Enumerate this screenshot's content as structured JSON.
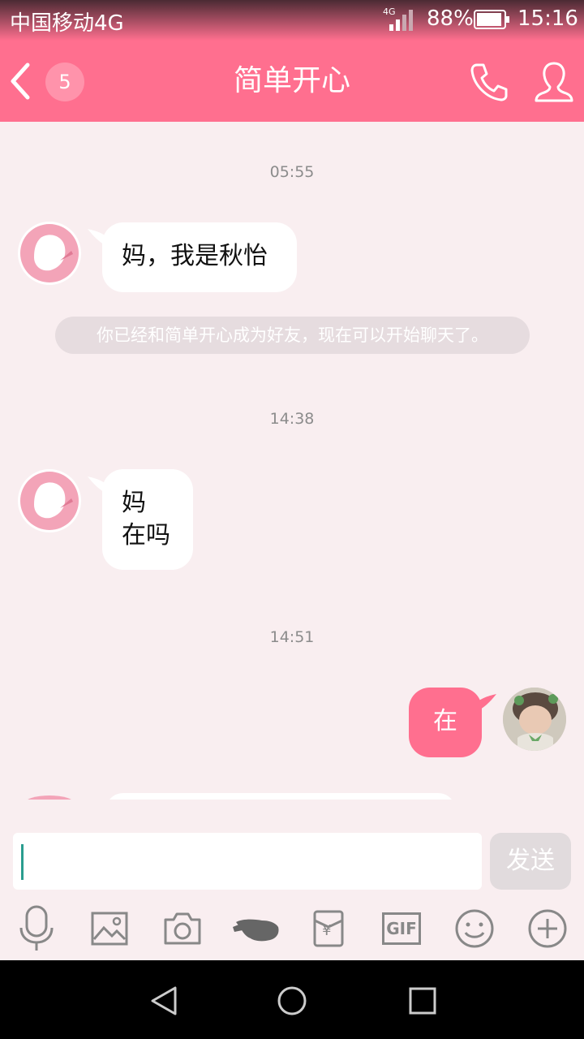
{
  "status_bar": {
    "carrier": "中国移动4G",
    "network": "4G",
    "battery": "88%",
    "time": "15:16"
  },
  "header": {
    "back_label": "<",
    "unread_count": "5",
    "title": "简单开心"
  },
  "messages": [
    {
      "type": "timestamp",
      "text": "05:55"
    },
    {
      "type": "incoming",
      "text": "妈，我是秋怡"
    },
    {
      "type": "system",
      "text": "你已经和简单开心成为好友，现在可以开始聊天了。"
    },
    {
      "type": "timestamp",
      "text": "14:38"
    },
    {
      "type": "incoming",
      "lines": [
        "妈",
        "在吗"
      ]
    },
    {
      "type": "timestamp",
      "text": "14:51"
    },
    {
      "type": "outgoing",
      "text": "在"
    }
  ],
  "composer": {
    "input_value": "",
    "send_label": "发送"
  },
  "toolbar": {
    "icons": [
      "microphone-icon",
      "image-icon",
      "camera-icon",
      "poke-hand-icon",
      "red-packet-icon",
      "gif-icon",
      "emoji-icon",
      "plus-icon"
    ],
    "gif_label": "GIF",
    "red_packet_symbol": "¥"
  },
  "colors": {
    "accent": "#ff6f8f",
    "background": "#f9eef0",
    "system_bubble": "#e6dcdf"
  }
}
